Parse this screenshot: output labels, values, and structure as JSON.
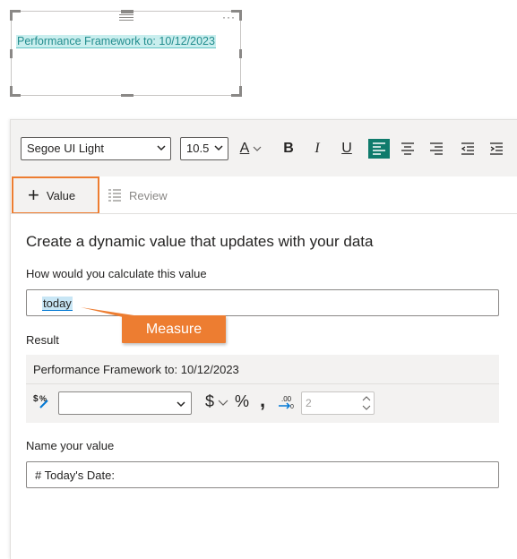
{
  "visual": {
    "text": "Performance Framework to: 10/12/2023",
    "more_label": "···"
  },
  "toolbar": {
    "font_family": "Segoe UI Light",
    "font_size": "10.5",
    "font_color_label": "A",
    "bold_label": "B",
    "italic_label": "I",
    "underline_label": "U"
  },
  "tabs": {
    "value_label": "Value",
    "review_label": "Review"
  },
  "panel": {
    "heading": "Create a dynamic value that updates with your data",
    "calc_label": "How would you calculate this value",
    "calc_value": "today",
    "callout": "Measure",
    "result_label": "Result",
    "result_text": "Performance Framework to: 10/12/2023",
    "format": {
      "currency_symbol": "$",
      "percent_symbol": "%",
      "comma_symbol": ",",
      "decimal_places": "2"
    },
    "name_label": "Name your value",
    "name_value": "# Today's Date:"
  },
  "colors": {
    "accent_orange": "#ed7d31",
    "align_active": "#0f7b6c",
    "highlight_teal": "#c9eeee"
  }
}
